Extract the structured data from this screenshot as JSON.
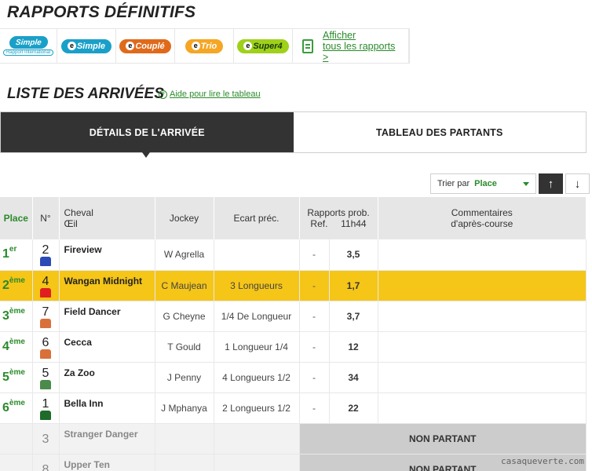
{
  "page": {
    "title": "RAPPORTS DÉFINITIFS",
    "list_title": "LISTE DES ARRIVÉES",
    "help_link": "Aide pour lire le tableau"
  },
  "payouts": {
    "bets": [
      {
        "label": "Simple",
        "sub": "Rapport International",
        "color": "#1aa0c8",
        "icon": "simple-international-logo"
      },
      {
        "label": "Simple",
        "prefix": "e",
        "color": "#1aa0c8",
        "icon": "e-simple-logo"
      },
      {
        "label": "Couplé",
        "prefix": "e",
        "color": "#e06a1b",
        "icon": "e-couple-logo"
      },
      {
        "label": "Trio",
        "prefix": "e",
        "color": "#f5a623",
        "icon": "e-trio-logo"
      },
      {
        "label": "Super4",
        "prefix": "e",
        "color": "#9fd11a",
        "icon": "e-super4-logo"
      }
    ],
    "all_link_line1": "Afficher",
    "all_link_line2": "tous les rapports >"
  },
  "tabs": [
    {
      "label": "DÉTAILS DE L'ARRIVÉE",
      "active": true
    },
    {
      "label": "TABLEAU DES PARTANTS",
      "active": false
    }
  ],
  "sort": {
    "label": "Trier par",
    "value": "Place",
    "up_icon": "arrow-up-icon",
    "down_icon": "arrow-down-icon"
  },
  "table": {
    "headers": {
      "place": "Place",
      "num": "N°",
      "horse_line1": "Cheval",
      "horse_line2": "Œil",
      "jockey": "Jockey",
      "ecart": "Ecart préc.",
      "rapports_line1": "Rapports prob.",
      "ref": "Ref.",
      "time": "11h44",
      "comments_line1": "Commentaires",
      "comments_line2": "d'après-course"
    },
    "rows": [
      {
        "place": "1",
        "sup": "er",
        "num": "2",
        "horse": "Fireview",
        "jockey": "W Agrella",
        "ecart": "",
        "ref": "-",
        "rapport": "3,5",
        "silk": "#2a4bb5",
        "highlight": false
      },
      {
        "place": "2",
        "sup": "ème",
        "num": "4",
        "horse": "Wangan Midnight",
        "jockey": "C Maujean",
        "ecart": "3 Longueurs",
        "ref": "-",
        "rapport": "1,7",
        "silk": "#e02020",
        "highlight": true
      },
      {
        "place": "3",
        "sup": "ème",
        "num": "7",
        "horse": "Field Dancer",
        "jockey": "G Cheyne",
        "ecart": "1/4 De Longueur",
        "ref": "-",
        "rapport": "3,7",
        "silk": "#d9703a",
        "highlight": false
      },
      {
        "place": "4",
        "sup": "ème",
        "num": "6",
        "horse": "Cecca",
        "jockey": "T Gould",
        "ecart": "1 Longueur 1/4",
        "ref": "-",
        "rapport": "12",
        "silk": "#d9703a",
        "highlight": false
      },
      {
        "place": "5",
        "sup": "ème",
        "num": "5",
        "horse": "Za Zoo",
        "jockey": "J Penny",
        "ecart": "4 Longueurs 1/2",
        "ref": "-",
        "rapport": "34",
        "silk": "#4a8a4a",
        "highlight": false
      },
      {
        "place": "6",
        "sup": "ème",
        "num": "1",
        "horse": "Bella Inn",
        "jockey": "J Mphanya",
        "ecart": "2 Longueurs 1/2",
        "ref": "-",
        "rapport": "22",
        "silk": "#1e6b2a",
        "highlight": false
      }
    ],
    "non_runners": [
      {
        "num": "3",
        "horse": "Stranger Danger",
        "status": "NON PARTANT"
      },
      {
        "num": "8",
        "horse": "Upper Ten",
        "status": "NON PARTANT"
      }
    ]
  },
  "watermark": "casaqueverte.com"
}
